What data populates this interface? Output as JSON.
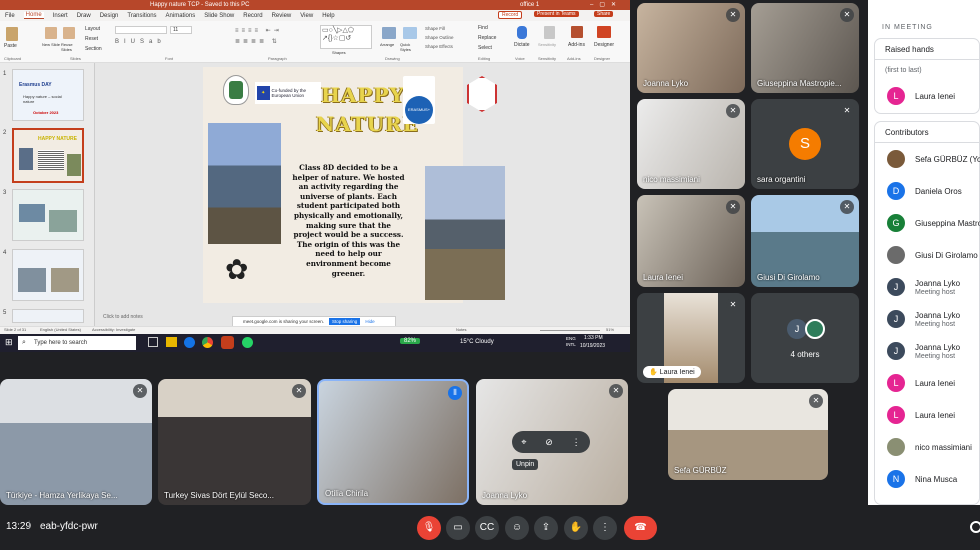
{
  "ppt": {
    "title": "Happy nature TCP - Saved to this PC",
    "account": "office 1",
    "tabs": [
      "File",
      "Home",
      "Insert",
      "Draw",
      "Design",
      "Transitions",
      "Animations",
      "Slide Show",
      "Record",
      "Review",
      "View",
      "Help"
    ],
    "active_tab": "Home",
    "record_btn": "Record",
    "present_btn": "Present in Teams",
    "share_btn": "Share",
    "ribbon_groups": [
      "Clipboard",
      "Slides",
      "Font",
      "Paragraph",
      "Drawing",
      "Editing",
      "Voice",
      "Sensitivity",
      "Add-ins",
      "Designer"
    ],
    "ribbon_buttons": [
      "Paste",
      "New Slide",
      "Reuse Slides",
      "Layout",
      "Reset",
      "Section",
      "Shapes",
      "Arrange",
      "Quick Styles",
      "Shape Fill",
      "Shape Outline",
      "Shape Effects",
      "Find",
      "Replace",
      "Select",
      "Dictate",
      "Sensitivity",
      "Add-ins",
      "Designer"
    ],
    "font_size": "11",
    "slide_numbers": [
      "1",
      "2",
      "3",
      "4",
      "5"
    ],
    "thumb1_text": "Erasmus DAY",
    "thumb1_sub": "Happy nature – social nature",
    "thumb1_date": "October 2023",
    "thumb2_title": "HAPPY NATURE",
    "slide_title_1": "HAPPY",
    "slide_title_2": "NATURE",
    "eu_text": "Co-funded by the European Union",
    "erasmus": "ERASMUS+",
    "body_text": "Class 8D decided to be a helper of nature. We hosted an activity regarding the universe of plants. Each student participated both physically and emotionally, making sure that the project would be a success. The origin of this was the need to help our environment become greener.",
    "notes": "Click to add notes",
    "share_notice": "meet.google.com is sharing your screen.",
    "stop_sharing": "Stop sharing",
    "hide": "Hide",
    "status_left": "Slide 2 of 31",
    "status_lang": "English (United States)",
    "status_access": "Accessibility: Investigate",
    "status_notes": "Notes",
    "zoom": "51%"
  },
  "taskbar": {
    "search": "Type here to search",
    "battery": "82%",
    "weather": "15°C Cloudy",
    "lang": "ENG INTL",
    "time": "1:33 PM",
    "date": "10/19/2023"
  },
  "tiles": {
    "joanna1": "Joanna Lyko",
    "giuseppina": "Giuseppina Mastropie...",
    "nico": "nico massimiani",
    "sara": "sara organtini",
    "sara_initial": "S",
    "laura_tile": "Laura Ienei",
    "giusi": "Giusi Di Girolamo",
    "laura_pin": "Laura Ienei",
    "others": "4 others",
    "others_initial": "J",
    "turkiye1": "Türkiye - Hamza Yerlikaya Se...",
    "turkiye2": "Turkey Sivas Dört Eylül Seco...",
    "otilia": "Otilia Chirila",
    "joanna2": "Joanna Lyko",
    "sefa": "Sefa GÜRBÜZ",
    "unpin": "Unpin"
  },
  "panel": {
    "in_meeting": "IN MEETING",
    "raised_hands": "Raised hands",
    "first_to_last": "(first to last)",
    "raised_person": "Laura Ienei",
    "raised_initial": "L",
    "contributors": "Contributors",
    "people": [
      {
        "name": "Sefa GÜRBÜZ (You)",
        "sub": "",
        "initial": "",
        "color": "#7a5a3a"
      },
      {
        "name": "Daniela Oros",
        "sub": "",
        "initial": "D",
        "color": "#1a73e8"
      },
      {
        "name": "Giuseppina Mastro",
        "sub": "",
        "initial": "G",
        "color": "#188038"
      },
      {
        "name": "Giusi Di Girolamo",
        "sub": "",
        "initial": "",
        "color": "#6b6b6b"
      },
      {
        "name": "Joanna Lyko",
        "sub": "Meeting host",
        "initial": "J",
        "color": "#3c4a5c"
      },
      {
        "name": "Joanna Lyko",
        "sub": "Meeting host",
        "initial": "J",
        "color": "#3c4a5c"
      },
      {
        "name": "Joanna Lyko",
        "sub": "Meeting host",
        "initial": "J",
        "color": "#3c4a5c"
      },
      {
        "name": "Laura Ienei",
        "sub": "",
        "initial": "L",
        "color": "#e52592"
      },
      {
        "name": "Laura Ienei",
        "sub": "",
        "initial": "L",
        "color": "#e52592"
      },
      {
        "name": "nico massimiani",
        "sub": "",
        "initial": "",
        "color": "#8a8f73"
      },
      {
        "name": "Nina Musca",
        "sub": "",
        "initial": "N",
        "color": "#1a73e8"
      }
    ]
  },
  "meet": {
    "time": "13:29",
    "code": "eab-yfdc-pwr"
  },
  "colors": {
    "end_call": "#ea4335",
    "mic_off": "#ea4335",
    "ppt_red": "#b7472a",
    "title_gold": "#e8d44d"
  }
}
